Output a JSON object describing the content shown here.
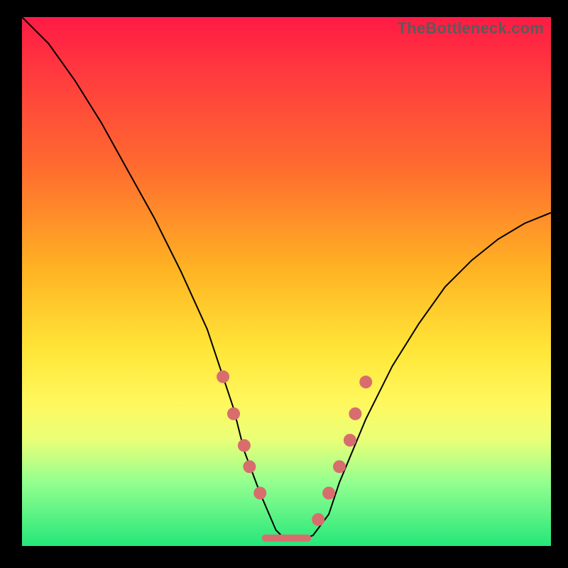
{
  "watermark": "TheBottleneck.com",
  "chart_data": {
    "type": "line",
    "title": "",
    "xlabel": "",
    "ylabel": "",
    "xlim": [
      0,
      100
    ],
    "ylim": [
      0,
      100
    ],
    "grid": false,
    "legend": false,
    "series": [
      {
        "name": "bottleneck-curve",
        "x": [
          0,
          5,
          10,
          15,
          20,
          25,
          30,
          35,
          40,
          42,
          45,
          48,
          50,
          52,
          55,
          58,
          60,
          65,
          70,
          75,
          80,
          85,
          90,
          95,
          100
        ],
        "y": [
          100,
          95,
          88,
          80,
          71,
          62,
          52,
          41,
          26,
          18,
          10,
          3,
          1,
          1,
          2,
          6,
          12,
          24,
          34,
          42,
          49,
          54,
          58,
          61,
          63
        ]
      }
    ],
    "markers": {
      "name": "highlight-dots",
      "x": [
        38,
        40,
        42,
        43,
        45,
        56,
        58,
        60,
        62,
        63,
        65
      ],
      "y": [
        32,
        25,
        19,
        15,
        10,
        5,
        10,
        15,
        20,
        25,
        31
      ]
    },
    "baseline": {
      "x": [
        46,
        54
      ],
      "y": [
        1.5,
        1.5
      ]
    },
    "colors": {
      "curve": "#000000",
      "dots": "#d86d6e",
      "gradient_top": "#ff1a44",
      "gradient_bottom": "#25e77a"
    }
  }
}
